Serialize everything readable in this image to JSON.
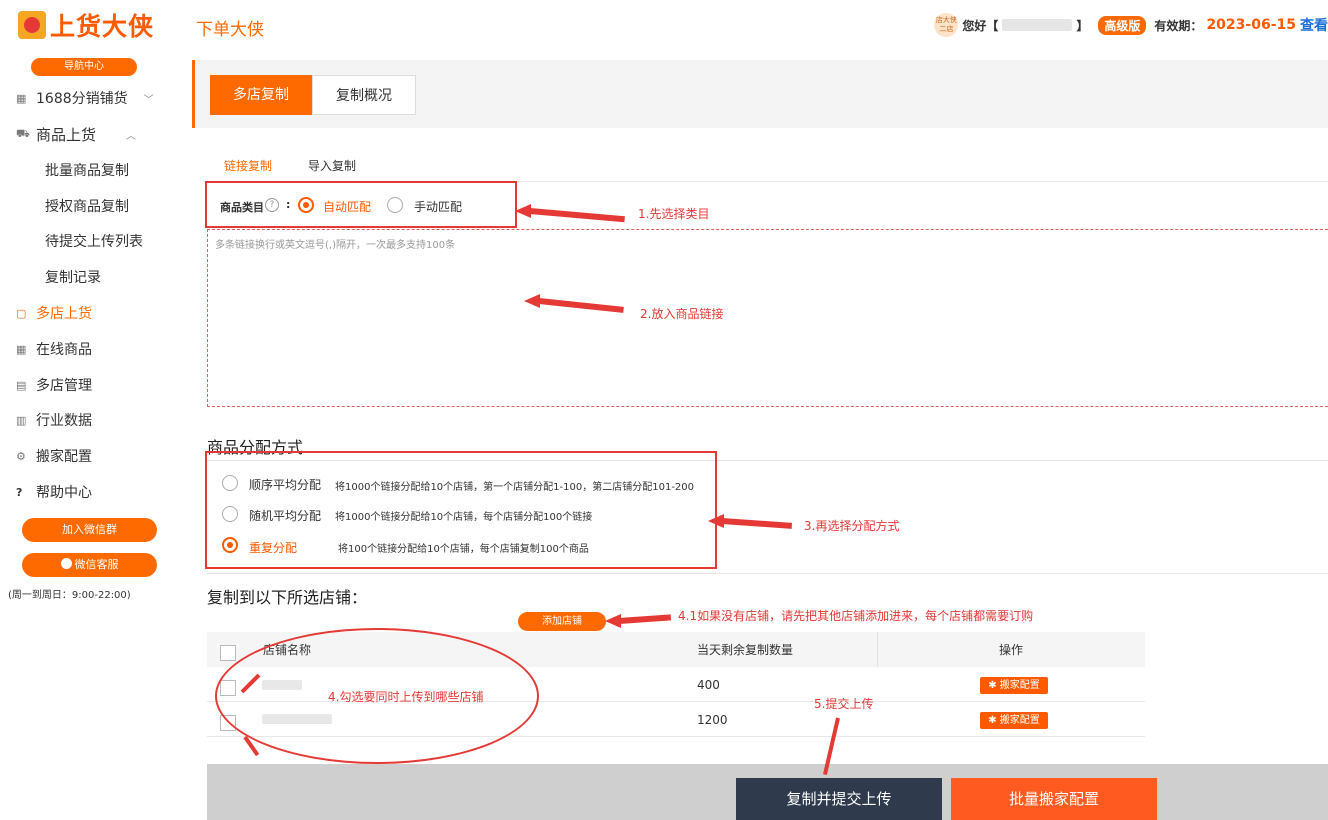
{
  "header": {
    "logo_text": "上货大侠",
    "app_name": "下单大侠",
    "avatar_text": "店大侠\n二店",
    "greeting": "您好【",
    "greeting_close": "】",
    "version_badge": "高级版",
    "expire_label": "有效期：",
    "expire_date": "2023-06-15",
    "view_link": "查看"
  },
  "sidebar": {
    "nav_badge": "导航中心",
    "items": [
      {
        "icon": "grid-icon",
        "glyph": "▦",
        "label": "1688分销铺货",
        "chevron": "﹀"
      },
      {
        "icon": "cart-icon",
        "glyph": "⛟",
        "label": "商品上货",
        "chevron": "︿"
      },
      {
        "label": "批量商品复制"
      },
      {
        "label": "授权商品复制"
      },
      {
        "label": "待提交上传列表"
      },
      {
        "label": "复制记录"
      },
      {
        "icon": "file-icon",
        "glyph": "▢",
        "label": "多店上货"
      },
      {
        "icon": "table-icon",
        "glyph": "▦",
        "label": "在线商品"
      },
      {
        "icon": "stores-icon",
        "glyph": "▤",
        "label": "多店管理"
      },
      {
        "icon": "chart-icon",
        "glyph": "▥",
        "label": "行业数据"
      },
      {
        "icon": "gear-icon",
        "glyph": "⚙",
        "label": "搬家配置"
      },
      {
        "icon": "help-icon",
        "glyph": "?",
        "label": "帮助中心"
      }
    ],
    "join_wechat_group": "加入微信群",
    "wechat_service": "微信客服",
    "service_hours": "(周一到周日：9:00-22:00)"
  },
  "tabs": {
    "multi_copy": "多店复制",
    "copy_overview": "复制概况"
  },
  "subtabs": {
    "link_copy": "链接复制",
    "import_copy": "导入复制"
  },
  "category": {
    "label": "商品类目",
    "help": "?",
    "colon": ":",
    "auto": "自动匹配",
    "manual": "手动匹配"
  },
  "links_input": {
    "placeholder": "多条链接换行或英文逗号(,)隔开，一次最多支持100条"
  },
  "distribution": {
    "title": "商品分配方式",
    "options": [
      {
        "label": "顺序平均分配",
        "desc": "将1000个链接分配给10个店铺，第一个店铺分配1-100，第二店铺分配101-200",
        "selected": false
      },
      {
        "label": "随机平均分配",
        "desc": "将1000个链接分配给10个店铺，每个店铺分配100个链接",
        "selected": false
      },
      {
        "label": "重复分配",
        "desc": "将100个链接分配给10个店铺，每个店铺复制100个商品",
        "selected": true
      }
    ]
  },
  "stores": {
    "title": "复制到以下所选店铺：",
    "add_button": "添加店铺",
    "columns": [
      "店铺名称",
      "当天剩余复制数量",
      "操作"
    ],
    "rows": [
      {
        "remaining": "400",
        "action": "搬家配置"
      },
      {
        "remaining": "1200",
        "action": "搬家配置"
      }
    ]
  },
  "annotations": {
    "step1": "1.先选择类目",
    "step2": "2.放入商品链接",
    "step3": "3.再选择分配方式",
    "step41": "4.1如果没有店铺，请先把其他店铺添加进来，每个店铺都需要订购",
    "step4": "4.勾选要同时上传到哪些店铺",
    "step5": "5.提交上传"
  },
  "footer": {
    "submit": "复制并提交上传",
    "batch_config": "批量搬家配置"
  },
  "colors": {
    "accent": "#ff6a00",
    "annotation_red": "#e53935",
    "submit_bg": "#2f3b4c"
  }
}
